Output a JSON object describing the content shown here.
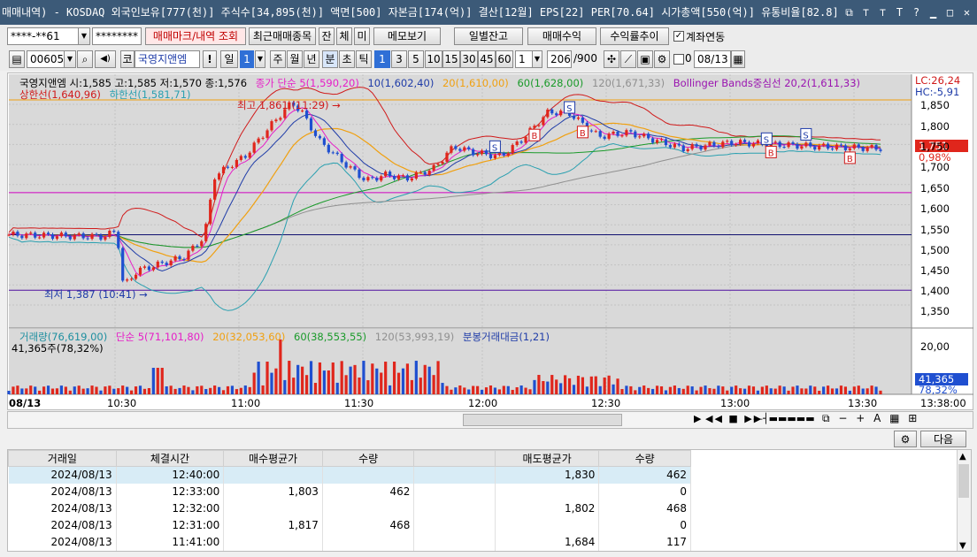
{
  "window": {
    "title": "매매내역) - KOSDAQ 외국인보유[777(천)] 주식수[34,895(천)] 액면[500] 자본금[174(억)] 결산[12월] EPS[22] PER[70.64] 시가총액[550(억)] 유통비율[82.8]"
  },
  "toolbar1": {
    "account": "****-**61",
    "password": "********",
    "btn_trade_mark": "매매마크/내역 조회",
    "btn_recent": "최근매매종목",
    "btn_jan": "잔",
    "btn_che": "체",
    "btn_mi": "미",
    "btn_memo": "메모보기",
    "btn_daily": "일별잔고",
    "btn_profit": "매매수익",
    "btn_trend": "수익률추이",
    "chk_link_label": "계좌연동",
    "chk_link_mark": "✓"
  },
  "toolbar2": {
    "code": "006050",
    "market": "코",
    "stock_name": "국영지앤엠",
    "btn_day": "일",
    "period_day": "1",
    "btn_week": "주",
    "btn_month": "월",
    "btn_year": "년",
    "btn_min": "분",
    "btn_sec": "초",
    "btn_tick": "틱",
    "periods": [
      "1",
      "3",
      "5",
      "10",
      "15",
      "30",
      "45",
      "60"
    ],
    "period_sel": "1",
    "count": "206",
    "count_total": "/900",
    "zero": "0",
    "date": "08/13"
  },
  "price_legend": {
    "ohlc": "국영지앤엠 시:1,585 고:1,585 저:1,570 종:1,576",
    "ma5": "종가 단순 5(1,590,20)",
    "ma10": "10(1,602,40)",
    "ma20": "20(1,610,00)",
    "ma60": "60(1,628,00)",
    "ma120": "120(1,671,33)",
    "boll": "Bollinger Bands중심선 20,2(1,611,33)",
    "boll_upper": "상한선(1,640,96)",
    "boll_lower": "하한선(1,581,71)"
  },
  "right_labels": {
    "lc": "LC:26,24",
    "hc": "HC:-5,91",
    "price": "1,751",
    "pct": "0,98%",
    "vol": "41,365",
    "vol_pct": "78,32%"
  },
  "price_axis": [
    "1,850",
    "1,800",
    "1,750",
    "1,700",
    "1,650",
    "1,600",
    "1,550",
    "1,500",
    "1,450",
    "1,400",
    "1,350"
  ],
  "annotations": {
    "high": "최고 1,861 (11:29)",
    "low": "최저 1,387 (10:41)"
  },
  "volume_legend": {
    "vol": "거래량(76,619,00)",
    "ma5": "단순 5(71,101,80)",
    "ma20": "20(32,053,60)",
    "ma60": "60(38,553,55)",
    "ma120": "120(53,993,19)",
    "amount": "분봉거래대금(1,21)",
    "sub": "41,365주(78,32%)"
  },
  "volume_axis": [
    "20,00"
  ],
  "time_axis": {
    "date": "08/13",
    "ticks": [
      "10:30",
      "11:00",
      "11:30",
      "12:00",
      "12:30",
      "13:00",
      "13:30"
    ],
    "end": "13:38:00"
  },
  "bottom": {
    "next_label": "다음"
  },
  "table": {
    "headers": [
      "거래일",
      "체결시간",
      "매수평균가",
      "수량",
      "",
      "매도평균가",
      "수량"
    ],
    "rows": [
      [
        "2024/08/13",
        "12:40:00",
        "",
        "",
        "",
        "1,830",
        "462"
      ],
      [
        "2024/08/13",
        "12:33:00",
        "1,803",
        "462",
        "",
        "",
        "0"
      ],
      [
        "2024/08/13",
        "12:32:00",
        "",
        "",
        "",
        "1,802",
        "468"
      ],
      [
        "2024/08/13",
        "12:31:00",
        "1,817",
        "468",
        "",
        "",
        "0"
      ],
      [
        "2024/08/13",
        "11:41:00",
        "",
        "",
        "",
        "1,684",
        "117"
      ]
    ]
  },
  "colors": {
    "up": "#e0261c",
    "down": "#1f4fd0",
    "ma5": "#e61ec8",
    "ma20": "#f0a010",
    "ma60": "#1a9a2a",
    "ma120": "#909090",
    "boll": "#d01a1a",
    "boll_lower": "#2aa0b0",
    "title": "#3c5a78"
  }
}
